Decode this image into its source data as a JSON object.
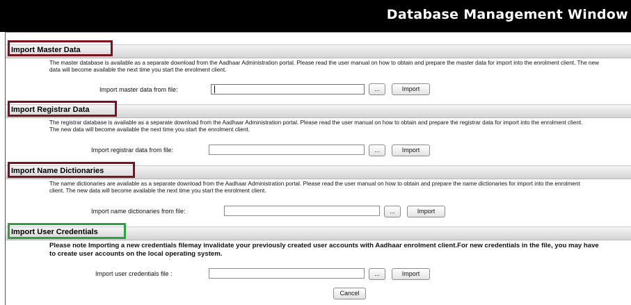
{
  "window": {
    "title": "Database Management Window"
  },
  "sections": [
    {
      "title": "Import Master Data",
      "description": "The master database is available as a separate download from the Aadhaar Administration portal. Please read the user manual on how to obtain and prepare the master data for import into the enrolment client. The new data will become available the next time you start the enrolment client.",
      "label": "Import master data from file:",
      "value": "",
      "browse_label": "...",
      "import_label": "Import"
    },
    {
      "title": "Import Registrar Data",
      "description": "The registrar database is available as a separate download from the Aadhaar Administration portal. Please read the user manual on how to obtain and prepare the registrar data for import into the enrolment client. The new data will become available the next time you start the enrolment client.",
      "label": "Import registrar data from file:",
      "value": "",
      "browse_label": "...",
      "import_label": "Import"
    },
    {
      "title": "Import Name Dictionaries",
      "description": "The name dictionaries are available as a separate download from the Aadhaar Administration portal. Please read the user manual on how to obtain and prepare the name dictionaries for import into the enrolment client. The new data will become available the next time you start the enrolment client.",
      "label": "Import name dictionaries from file:",
      "value": "",
      "browse_label": "...",
      "import_label": "Import"
    },
    {
      "title": "Import User Credentials",
      "description": "Please note Importing a new credentials filemay invalidate your previously created user accounts with Aadhaar enrolment client.For new credentials in the file, you may have to create user accounts on the local operating system.",
      "label": "Import user credentials file :",
      "value": "",
      "browse_label": "...",
      "import_label": "Import"
    }
  ],
  "cancel_label": "Cancel",
  "colors": {
    "highlight_dark_red": "#7a1220",
    "highlight_green": "#2ea043",
    "titlebar": "#000000"
  }
}
